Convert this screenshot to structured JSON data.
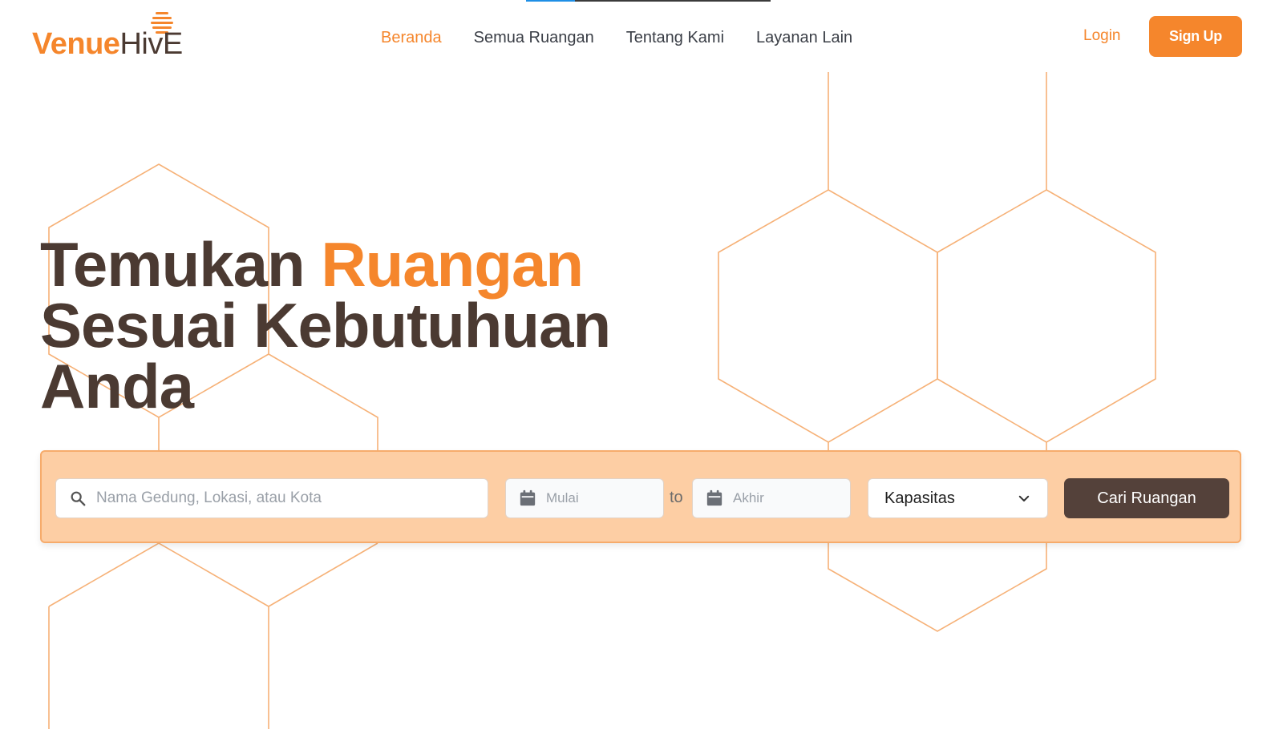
{
  "brand": {
    "logo_part1": "Venue",
    "logo_part2": "HivE",
    "primary_color": "#f5862c",
    "dark_color": "#4b3a32",
    "search_bar_bg": "#fdcea4"
  },
  "page_loading_progress": 0.2,
  "nav": {
    "items": [
      {
        "label": "Beranda",
        "active": true
      },
      {
        "label": "Semua Ruangan",
        "active": false
      },
      {
        "label": "Tentang Kami",
        "active": false
      },
      {
        "label": "Layanan Lain",
        "active": false
      }
    ]
  },
  "auth": {
    "login_label": "Login",
    "signup_label": "Sign Up"
  },
  "hero": {
    "line1_part1": "Temukan ",
    "line1_accent": "Ruangan",
    "line2": "Sesuai Kebutuhuan",
    "line3": "Anda"
  },
  "search": {
    "query_placeholder": "Nama Gedung, Lokasi, atau Kota",
    "start_placeholder": "Mulai",
    "separator": "to",
    "end_placeholder": "Akhir",
    "capacity_selected": "Kapasitas",
    "submit_label": "Cari Ruangan",
    "icons": [
      "search-icon",
      "calendar-icon",
      "calendar-icon",
      "chevron-down-icon"
    ]
  }
}
